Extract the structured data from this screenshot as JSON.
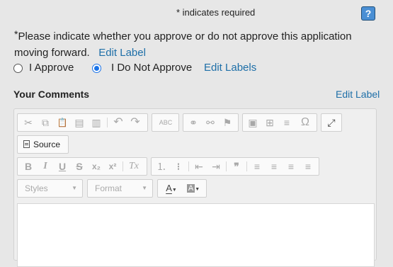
{
  "header": {
    "required_note": "* indicates required",
    "help_label": "?"
  },
  "question": {
    "star": "*",
    "text": "Please indicate whether you approve or do not approve this application moving forward.",
    "edit_label": "Edit Label"
  },
  "options": {
    "approve": "I Approve",
    "not_approve": "I Do Not Approve",
    "selected": "I Do Not Approve",
    "edit_labels": "Edit Labels"
  },
  "comments": {
    "title": "Your Comments",
    "edit_label": "Edit Label"
  },
  "editor": {
    "source_label": "Source",
    "styles_placeholder": "Styles",
    "format_placeholder": "Format",
    "toolbar_icons": {
      "cut": "✂",
      "copy": "⧉",
      "paste": "📋",
      "paste_text": "▤",
      "paste_word": "▥",
      "undo": "↶",
      "redo": "↷",
      "spellcheck": "ABC",
      "link": "⚭",
      "unlink": "⚯",
      "anchor": "⚑",
      "image": "▣",
      "table": "⊞",
      "hline": "≡",
      "special_char": "Ω",
      "maximize": "⤢",
      "bold": "B",
      "italic": "I",
      "underline": "U",
      "strike": "S",
      "subscript": "x₂",
      "superscript": "x²",
      "remove_format": "Tx",
      "numbered_list": "⒈",
      "bulleted_list": "⁝",
      "outdent": "⇤",
      "indent": "⇥",
      "blockquote": "❞",
      "align_left": "≡",
      "align_center": "≡",
      "align_right": "≡",
      "justify": "≡",
      "text_color": "A",
      "bg_color": "A"
    }
  }
}
